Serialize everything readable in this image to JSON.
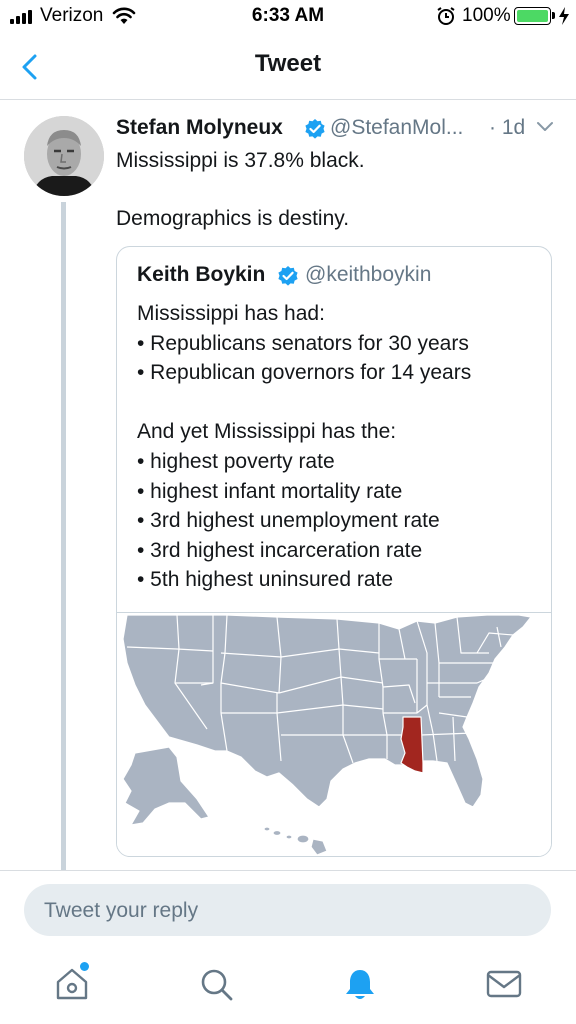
{
  "status_bar": {
    "carrier": "Verizon",
    "time": "6:33 AM",
    "battery": "100%",
    "battery_level": 1.0
  },
  "nav": {
    "title": "Tweet"
  },
  "tweet": {
    "display_name": "Stefan Molyneux",
    "handle": "@StefanMol...",
    "timestamp": "· 1d",
    "text": "Mississippi is 37.8% black.\n\nDemographics is destiny."
  },
  "quote": {
    "display_name": "Keith Boykin",
    "handle": "@keithboykin",
    "lines": [
      "Mississippi has had:",
      "• Republicans senators for 30 years",
      "• Republican governors for 14 years",
      "",
      "And yet Mississippi has the:",
      "• highest poverty rate",
      "• highest infant mortality rate",
      "• 3rd highest unemployment rate",
      "• 3rd highest incarceration rate",
      "• 5th highest uninsured rate"
    ]
  },
  "reply": {
    "placeholder": "Tweet your reply"
  },
  "tabs": [
    {
      "name": "home-icon"
    },
    {
      "name": "search-icon"
    },
    {
      "name": "bell-icon"
    },
    {
      "name": "mail-icon"
    }
  ],
  "colors": {
    "accent": "#1da1f2",
    "highlight_state": "#a2261f",
    "map_states": "#aab4c2"
  }
}
